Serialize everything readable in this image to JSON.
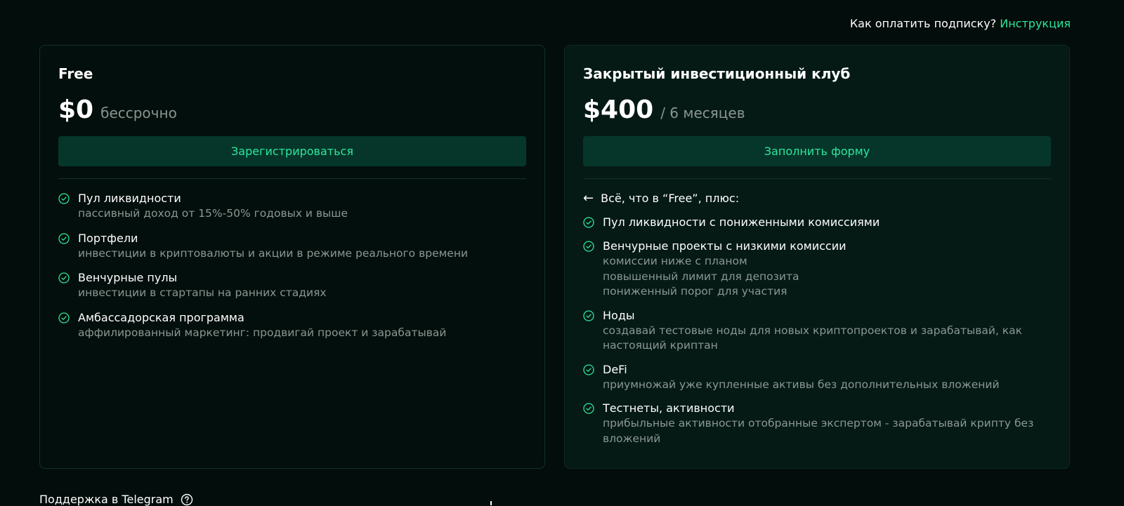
{
  "header": {
    "question": "Как оплатить подписку?",
    "link_label": "Инструкция"
  },
  "plans": {
    "free": {
      "name": "Free",
      "price": "$0",
      "period": "бессрочно",
      "cta": "Зарегистрироваться",
      "features": [
        {
          "title": "Пул ликвидности",
          "desc": [
            "пассивный доход от 15%-50% годовых и выше"
          ]
        },
        {
          "title": "Портфели",
          "desc": [
            "инвестиции в криптовалюты и акции в режиме реального времени"
          ]
        },
        {
          "title": "Венчурные пулы",
          "desc": [
            "инвестиции в стартапы на ранних стадиях"
          ]
        },
        {
          "title": "Амбассадорская программа",
          "desc": [
            "аффилированный маркетинг: продвигай проект и зарабатывай"
          ]
        }
      ]
    },
    "club": {
      "name": "Закрытый инвестиционный клуб",
      "price": "$400",
      "period": "/ 6 месяцев",
      "cta": "Заполнить форму",
      "intro": "Всё, что в “Free”, плюс:",
      "features": [
        {
          "title": "Пул ликвидности с пониженными комиссиями",
          "desc": []
        },
        {
          "title": "Венчурные проекты с низкими комиссии",
          "desc": [
            "комиссии ниже с планом",
            "повышенный лимит для депозита",
            "пониженный порог для участия"
          ]
        },
        {
          "title": "Ноды",
          "desc": [
            "создавай тестовые ноды для новых криптопроектов и зарабатывай, как",
            "настоящий криптан"
          ]
        },
        {
          "title": "DeFi",
          "desc": [
            "приумножай уже купленные активы без дополнительных вложений"
          ]
        },
        {
          "title": "Тестнеты, активности",
          "desc": [
            "прибыльные активности отобранные экспертом - зарабатывай крипту без",
            "вложений"
          ]
        }
      ]
    }
  },
  "footer": {
    "support_label": "Поддержка в Telegram",
    "support_icon": "question-icon"
  },
  "colors": {
    "accent": "#2ee59d",
    "background": "#030d0b",
    "muted": "#8b9792",
    "button_bg": "#06362a"
  }
}
